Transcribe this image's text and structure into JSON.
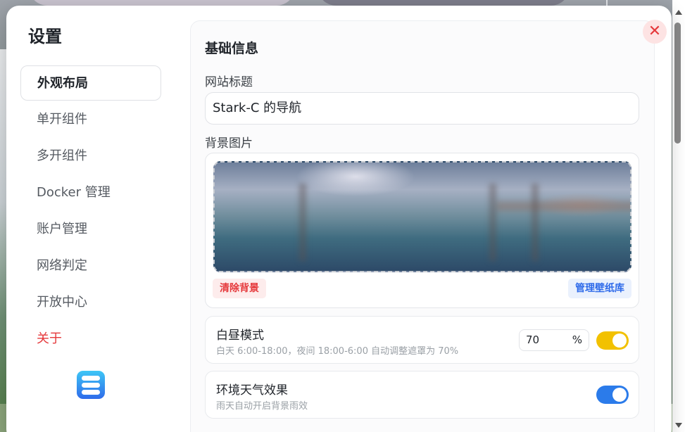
{
  "sidebar": {
    "title": "设置",
    "items": [
      {
        "label": "外观布局",
        "active": true
      },
      {
        "label": "单开组件"
      },
      {
        "label": "多开组件"
      },
      {
        "label": "Docker 管理"
      },
      {
        "label": "账户管理"
      },
      {
        "label": "网络判定"
      },
      {
        "label": "开放中心"
      },
      {
        "label": "关于",
        "danger": true
      }
    ],
    "logo_icon": "stacked-bars-icon"
  },
  "content": {
    "section_title": "基础信息",
    "site_title_label": "网站标题",
    "site_title_value": "Stark-C 的导航",
    "background_label": "背景图片",
    "clear_background": "清除背景",
    "manage_wallpaper": "管理壁纸库",
    "day_mode": {
      "title": "白昼模式",
      "description": "白天 6:00-18:00，夜间 18:00-6:00 自动调整遮罩为 70%",
      "value": "70",
      "suffix": "%",
      "enabled": true,
      "color": "#f2c100"
    },
    "weather_effect": {
      "title": "环境天气效果",
      "description": "雨天自动开启背景雨效",
      "enabled": true,
      "color": "#2b7bea"
    }
  },
  "close_icon": "close-icon",
  "colors": {
    "danger": "#e5383b",
    "accent": "#2f6bea"
  }
}
